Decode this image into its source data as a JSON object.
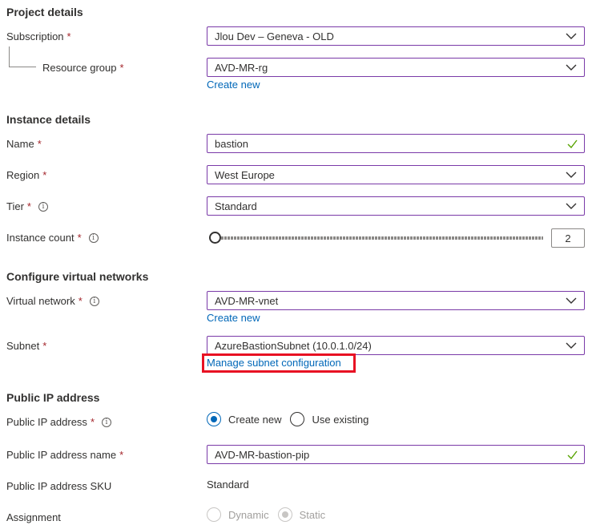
{
  "project": {
    "title": "Project details",
    "subscription_label": "Subscription",
    "subscription_value": "Jlou Dev – Geneva - OLD",
    "resource_group_label": "Resource group",
    "resource_group_value": "AVD-MR-rg",
    "create_new": "Create new"
  },
  "instance": {
    "title": "Instance details",
    "name_label": "Name",
    "name_value": "bastion",
    "region_label": "Region",
    "region_value": "West Europe",
    "tier_label": "Tier",
    "tier_value": "Standard",
    "count_label": "Instance count",
    "count_value": "2",
    "count_level": 0
  },
  "vnet": {
    "title": "Configure virtual networks",
    "network_label": "Virtual network",
    "network_value": "AVD-MR-vnet",
    "create_new": "Create new",
    "subnet_label": "Subnet",
    "subnet_value": "AzureBastionSubnet (10.0.1.0/24)",
    "manage_subnet": "Manage subnet configuration"
  },
  "ip": {
    "title": "Public IP address",
    "address_label": "Public IP address",
    "opt_create": "Create new",
    "opt_existing": "Use existing",
    "name_label": "Public IP address name",
    "name_value": "AVD-MR-bastion-pip",
    "sku_label": "Public IP address SKU",
    "sku_value": "Standard",
    "assignment_label": "Assignment",
    "opt_dynamic": "Dynamic",
    "opt_static": "Static"
  },
  "required_marker": "*",
  "info_glyph": "i",
  "colors": {
    "accent": "#0067b8",
    "field_border": "#7a3aa8",
    "required": "#a4262c",
    "highlight": "#e81123",
    "valid": "#57a300"
  }
}
